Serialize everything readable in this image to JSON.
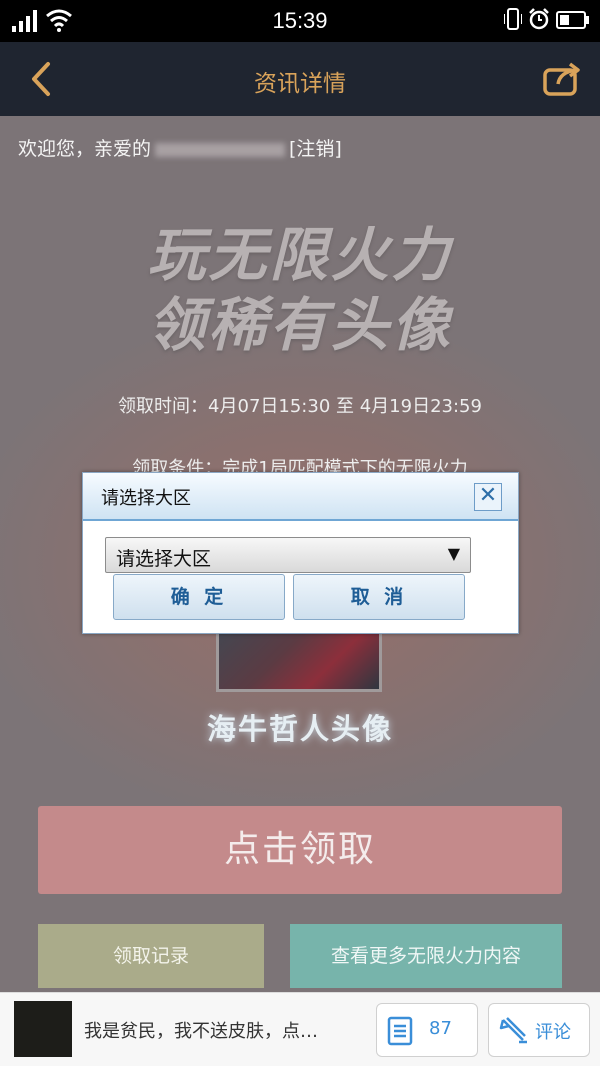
{
  "status_bar": {
    "time": "15:39"
  },
  "header": {
    "title": "资讯详情"
  },
  "page": {
    "welcome": "欢迎您，亲爱的",
    "logout": "[注销]",
    "banner_line1": "玩无限火力",
    "banner_line2": "领稀有头像",
    "claim_time": "领取时间：4月07日15:30 至 4月19日23:59",
    "claim_condition": "领取条件：完成1局匹配模式下的无限火力",
    "avatar_name": "海牛哲人头像",
    "claim_button": "点击领取",
    "record_button": "领取记录",
    "more_button": "查看更多无限火力内容"
  },
  "dialog": {
    "title": "请选择大区",
    "close": "✕",
    "select_value": "请选择大区",
    "confirm": "确 定",
    "cancel": "取 消"
  },
  "bottom_bar": {
    "article_text": "我是贫民，我不送皮肤，点…",
    "comment_count": "87",
    "comment_label": "评论"
  }
}
